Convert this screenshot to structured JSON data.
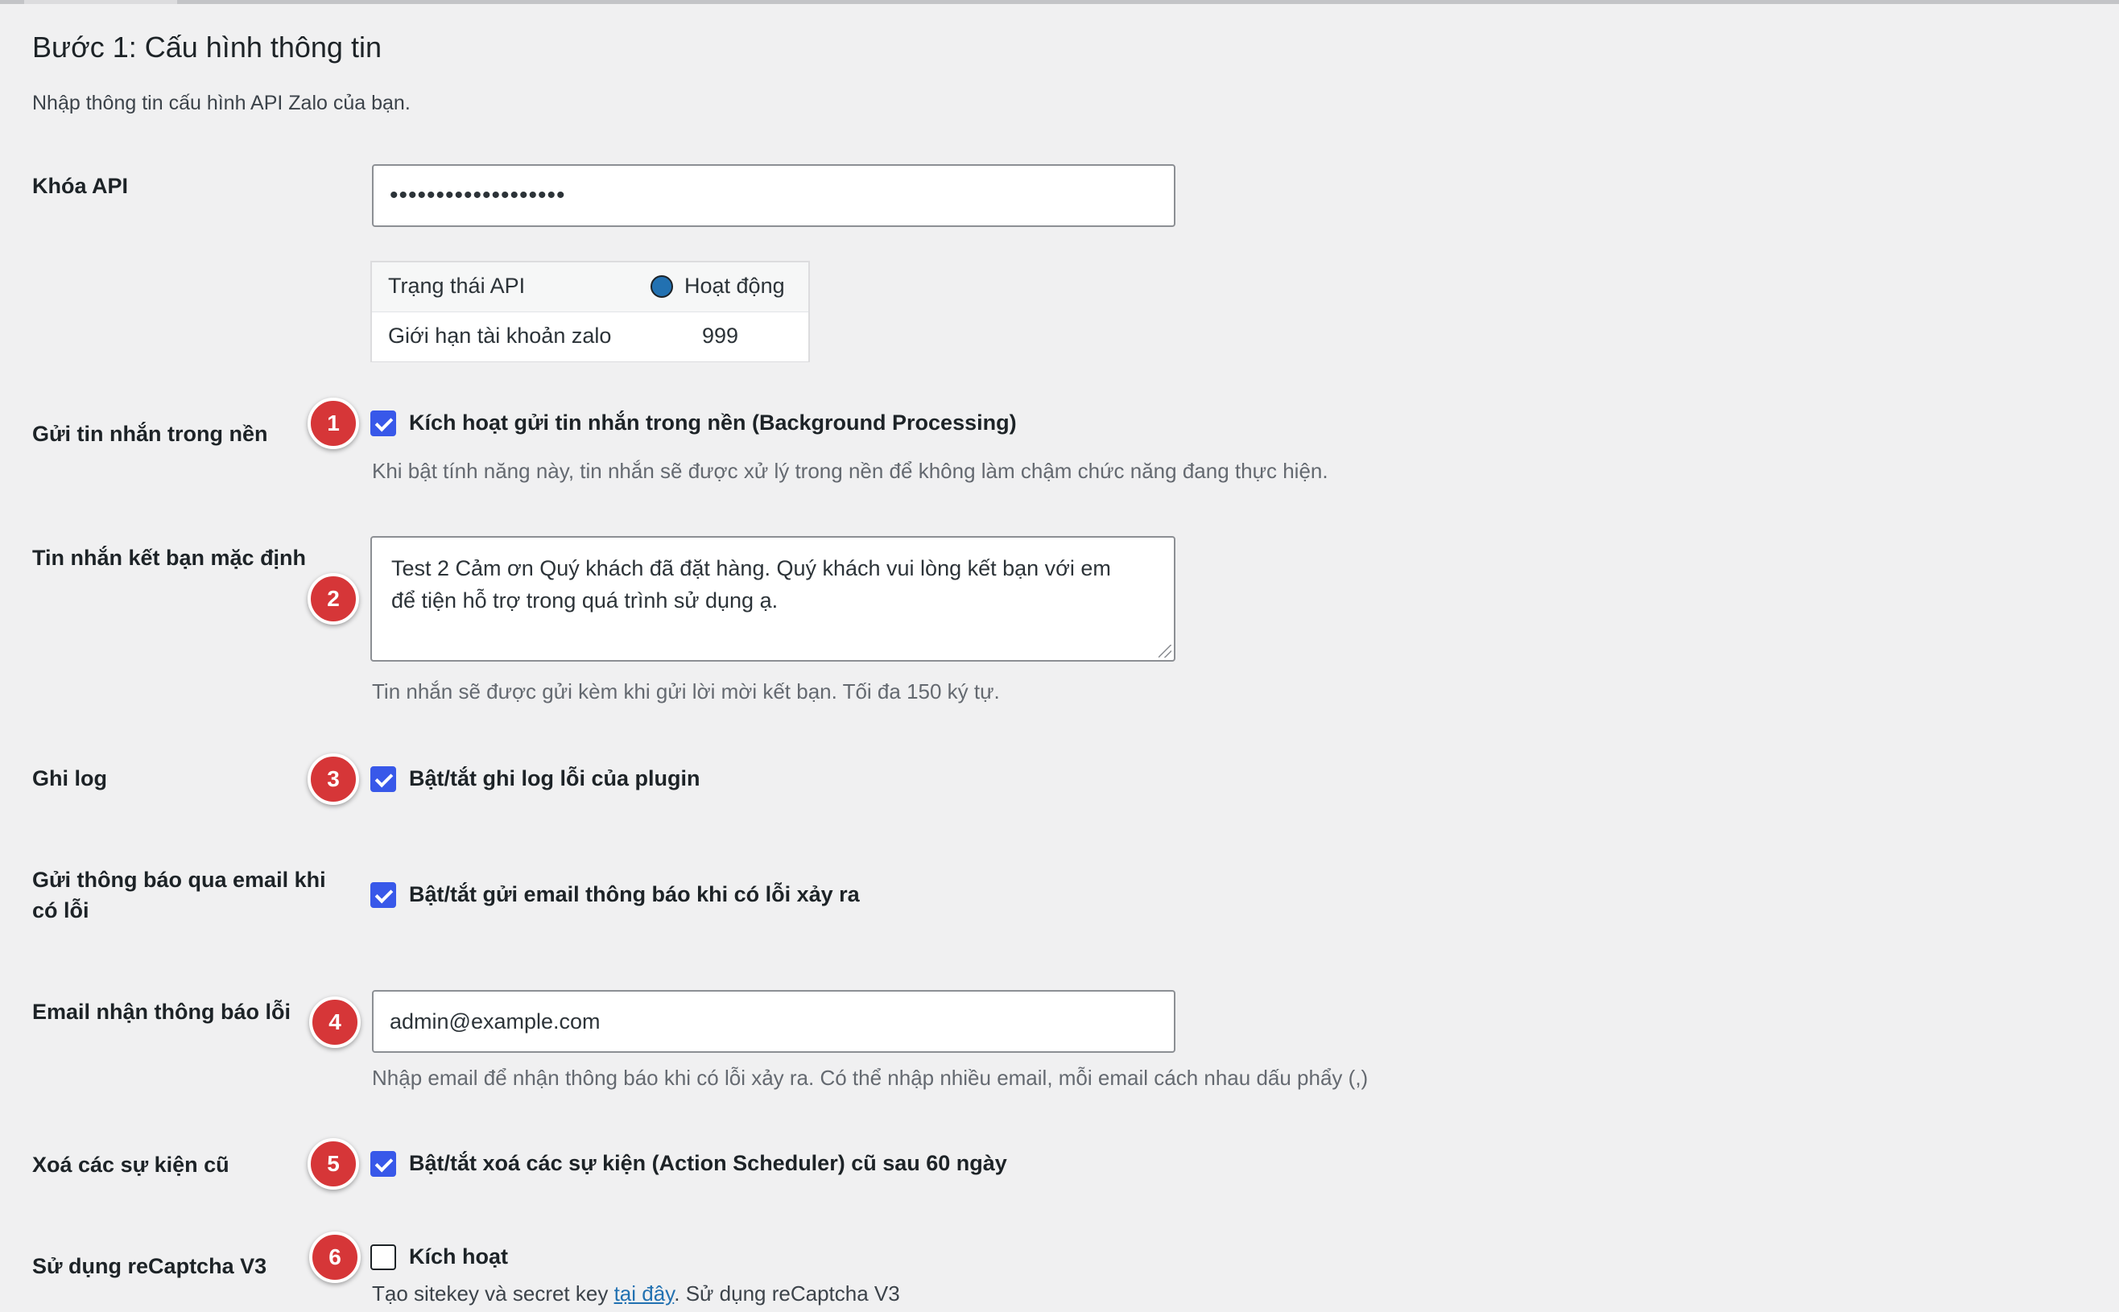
{
  "section": {
    "title": "Bước 1: Cấu hình thông tin",
    "intro": "Nhập thông tin cấu hình API Zalo của bạn."
  },
  "api_key": {
    "label": "Khóa API",
    "value": "•••••••••••••••••••"
  },
  "api_status": {
    "status_label": "Trạng thái API",
    "status_value": "Hoạt động",
    "status_color": "#2271b1",
    "limit_label": "Giới hạn tài khoản zalo",
    "limit_value": "999"
  },
  "background": {
    "badge": "1",
    "label": "Gửi tin nhắn trong nền",
    "checkbox_label": "Kích hoạt gửi tin nhắn trong nền (Background Processing)",
    "checked": true,
    "description": "Khi bật tính năng này, tin nhắn sẽ được xử lý trong nền để không làm chậm chức năng đang thực hiện."
  },
  "friend_message": {
    "badge": "2",
    "label": "Tin nhắn kết bạn mặc định",
    "value": "Test 2 Cảm ơn Quý khách đã đặt hàng. Quý khách vui lòng kết bạn với em\nđể tiện hỗ trợ trong quá trình sử dụng ạ.",
    "description": "Tin nhắn sẽ được gửi kèm khi gửi lời mời kết bạn. Tối đa 150 ký tự."
  },
  "logging": {
    "badge": "3",
    "label": "Ghi log",
    "checkbox_label": "Bật/tắt ghi log lỗi của plugin",
    "checked": true
  },
  "email_notify": {
    "label_line1": "Gửi thông báo qua email khi",
    "label_line2": "có lỗi",
    "checkbox_label": "Bật/tắt gửi email thông báo khi có lỗi xảy ra",
    "checked": true
  },
  "error_email": {
    "badge": "4",
    "label": "Email nhận thông báo lỗi",
    "value": "admin@example.com",
    "description": "Nhập email để nhận thông báo khi có lỗi xảy ra. Có thể nhập nhiều email, mỗi email cách nhau dấu phẩy (,)"
  },
  "cleanup": {
    "badge": "5",
    "label": "Xoá các sự kiện cũ",
    "checkbox_label": "Bật/tắt xoá các sự kiện (Action Scheduler) cũ sau 60 ngày",
    "checked": true
  },
  "recaptcha": {
    "badge": "6",
    "label": "Sử dụng reCaptcha V3",
    "checkbox_label": "Kích hoạt",
    "checked": false,
    "desc_prefix": "Tạo sitekey và secret key ",
    "desc_link": "tại đây",
    "desc_suffix": ". Sử dụng reCaptcha V3"
  },
  "colors": {
    "badge": "#d63638",
    "checkbox": "#3858e9",
    "link": "#2271b1"
  }
}
